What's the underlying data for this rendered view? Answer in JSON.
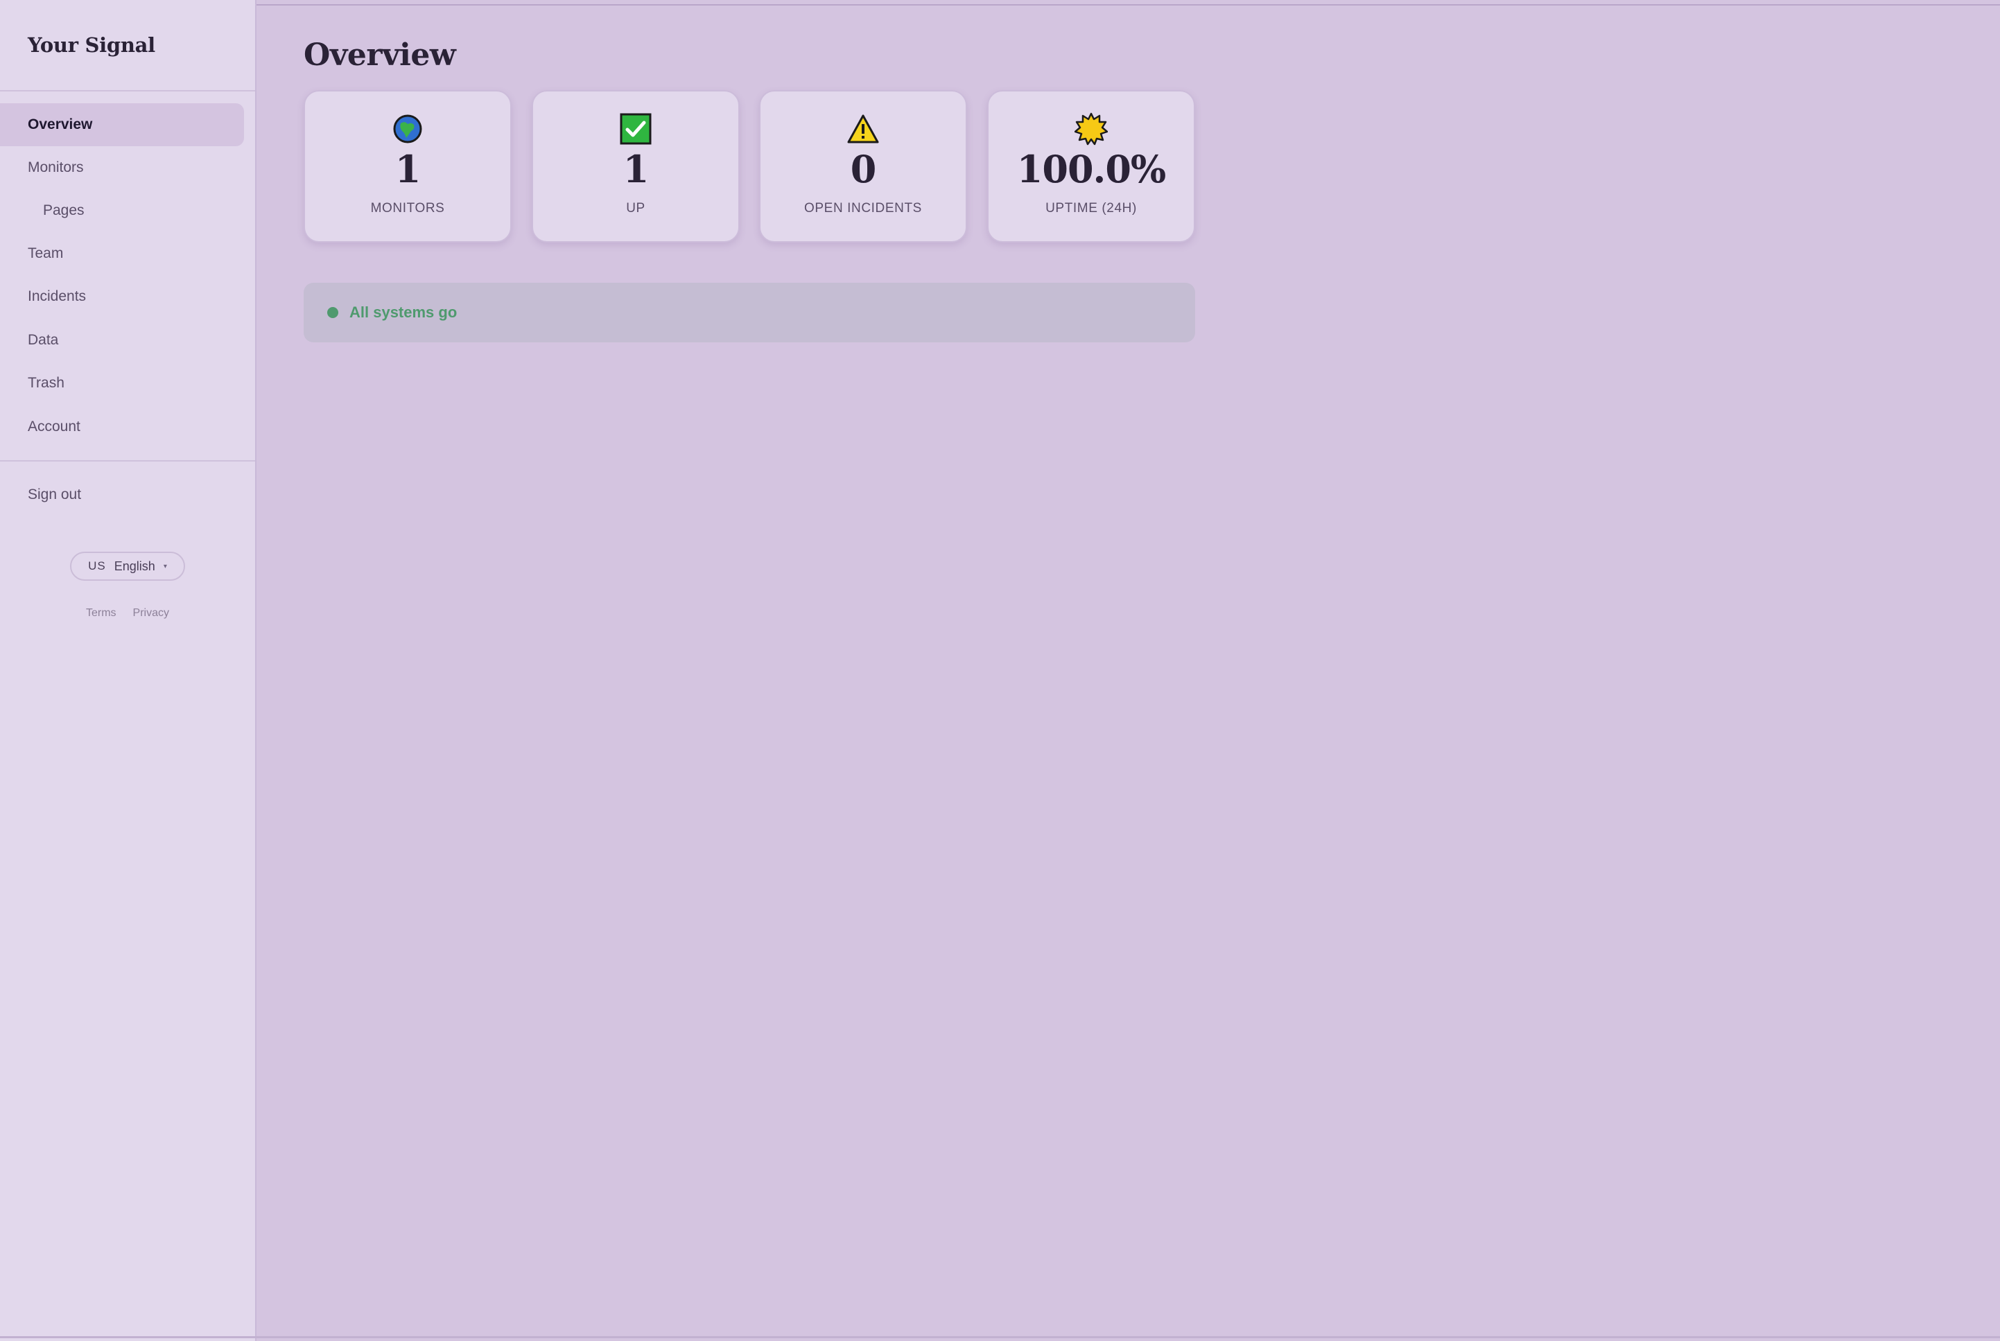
{
  "sidebar": {
    "brand": "Your Signal",
    "nav": [
      {
        "label": "Overview",
        "active": true
      },
      {
        "label": "Monitors"
      },
      {
        "label": "Pages",
        "sub": true
      },
      {
        "label": "Team"
      },
      {
        "label": "Incidents"
      },
      {
        "label": "Data"
      },
      {
        "label": "Trash"
      },
      {
        "label": "Account"
      }
    ],
    "signout": "Sign out",
    "language": {
      "flag": "US",
      "label": "English",
      "caret": "▾"
    },
    "footer": {
      "terms": "Terms",
      "privacy": "Privacy"
    }
  },
  "main": {
    "title": "Overview",
    "cards": [
      {
        "icon": "globe-icon",
        "value": "1",
        "label": "MONITORS"
      },
      {
        "icon": "check-box-icon",
        "value": "1",
        "label": "UP"
      },
      {
        "icon": "warning-icon",
        "value": "0",
        "label": "OPEN INCIDENTS"
      },
      {
        "icon": "sun-badge-icon",
        "value": "100.0%",
        "label": "UPTIME (24H)"
      }
    ],
    "status": {
      "text": "All systems go",
      "color": "#4f9a6e"
    }
  },
  "colors": {
    "background": "#d4c4e0",
    "sidebar": "#e2d8ec",
    "status_bar": "#c5bdd3",
    "ok_green": "#4f9a6e"
  }
}
